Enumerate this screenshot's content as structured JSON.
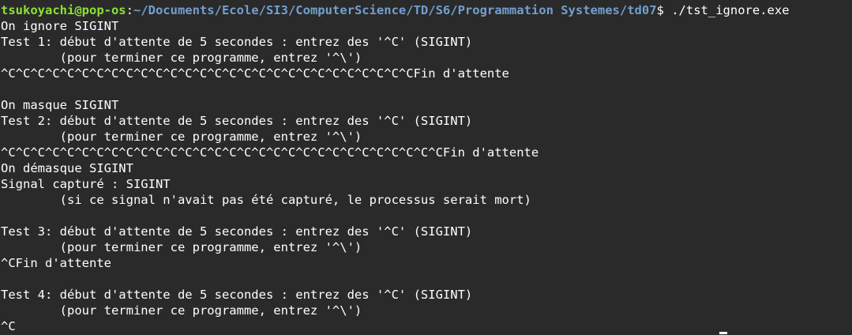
{
  "prompt": {
    "user_host": "tsukoyachi@pop-os",
    "separator": ":",
    "path": "~/Documents/Ecole/SI3/ComputerScience/TD/S6/Programmation Systemes/td07",
    "symbol": "$ ",
    "command": "./tst_ignore.exe"
  },
  "output": [
    "On ignore SIGINT",
    "Test 1: début d'attente de 5 secondes : entrez des '^C' (SIGINT)",
    "        (pour terminer ce programme, entrez '^\\')",
    "^C^C^C^C^C^C^C^C^C^C^C^C^C^C^C^C^C^C^C^C^C^C^C^C^C^C^C^CFin d'attente",
    "",
    "On masque SIGINT",
    "Test 2: début d'attente de 5 secondes : entrez des '^C' (SIGINT)",
    "        (pour terminer ce programme, entrez '^\\')",
    "^C^C^C^C^C^C^C^C^C^C^C^C^C^C^C^C^C^C^C^C^C^C^C^C^C^C^C^C^C^CFin d'attente",
    "On démasque SIGINT",
    "Signal capturé : SIGINT",
    "        (si ce signal n'avait pas été capturé, le processus serait mort)",
    "",
    "Test 3: début d'attente de 5 secondes : entrez des '^C' (SIGINT)",
    "        (pour terminer ce programme, entrez '^\\')",
    "^CFin d'attente",
    "",
    "Test 4: début d'attente de 5 secondes : entrez des '^C' (SIGINT)",
    "        (pour terminer ce programme, entrez '^\\')",
    "^C"
  ]
}
